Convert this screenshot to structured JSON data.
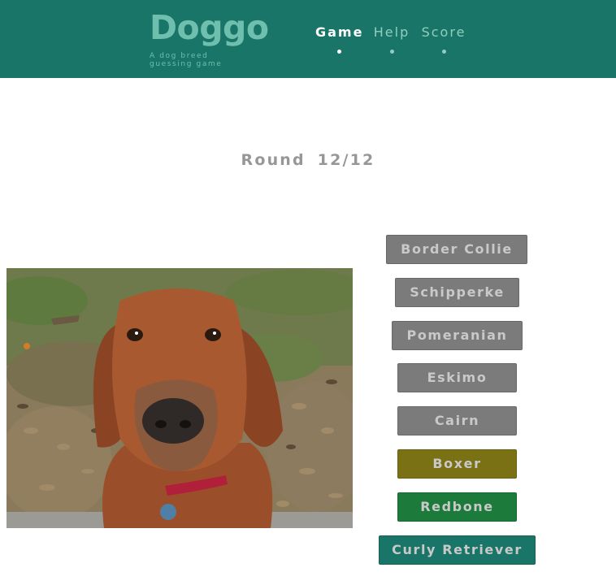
{
  "header": {
    "logo": "Doggo",
    "tagline": "A dog breed guessing game",
    "nav": [
      {
        "label": "Game",
        "active": true
      },
      {
        "label": "Help",
        "active": false
      },
      {
        "label": "Score",
        "active": false
      }
    ]
  },
  "round": {
    "label": "Round 12/12"
  },
  "photo": {
    "subject": "dog-photo"
  },
  "answers": [
    {
      "label": "Border Collie",
      "state": "neutral",
      "color": "#7b7b7b"
    },
    {
      "label": "Schipperke",
      "state": "neutral",
      "color": "#7b7b7b"
    },
    {
      "label": "Pomeranian",
      "state": "neutral",
      "color": "#7b7b7b"
    },
    {
      "label": "Eskimo",
      "state": "neutral",
      "color": "#7b7b7b"
    },
    {
      "label": "Cairn",
      "state": "neutral",
      "color": "#7b7b7b"
    },
    {
      "label": "Boxer",
      "state": "highlight",
      "color": "#7a7114"
    },
    {
      "label": "Redbone",
      "state": "correct",
      "color": "#1c7a3b"
    },
    {
      "label": "Curly Retriever",
      "state": "selected",
      "color": "#197567"
    }
  ],
  "colors": {
    "header_bg": "#197567",
    "round_text": "#979797"
  }
}
